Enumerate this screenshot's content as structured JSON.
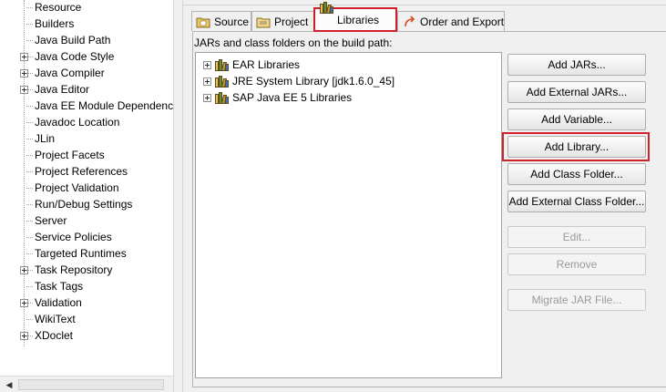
{
  "left_tree": {
    "items": [
      {
        "label": "Resource",
        "expandable": false
      },
      {
        "label": "Builders",
        "expandable": false
      },
      {
        "label": "Java Build Path",
        "expandable": false
      },
      {
        "label": "Java Code Style",
        "expandable": true
      },
      {
        "label": "Java Compiler",
        "expandable": true
      },
      {
        "label": "Java Editor",
        "expandable": true
      },
      {
        "label": "Java EE Module Dependenc",
        "expandable": false
      },
      {
        "label": "Javadoc Location",
        "expandable": false
      },
      {
        "label": "JLin",
        "expandable": false
      },
      {
        "label": "Project Facets",
        "expandable": false
      },
      {
        "label": "Project References",
        "expandable": false
      },
      {
        "label": "Project Validation",
        "expandable": false
      },
      {
        "label": "Run/Debug Settings",
        "expandable": false
      },
      {
        "label": "Server",
        "expandable": false
      },
      {
        "label": "Service Policies",
        "expandable": false
      },
      {
        "label": "Targeted Runtimes",
        "expandable": false
      },
      {
        "label": "Task Repository",
        "expandable": true
      },
      {
        "label": "Task Tags",
        "expandable": false
      },
      {
        "label": "Validation",
        "expandable": true
      },
      {
        "label": "WikiText",
        "expandable": false
      },
      {
        "label": "XDoclet",
        "expandable": true
      }
    ]
  },
  "tabs": [
    {
      "label": "Source",
      "icon": "source-folder-icon"
    },
    {
      "label": "Project",
      "icon": "project-folder-icon"
    },
    {
      "label": "Libraries",
      "icon": "libraries-icon",
      "active": true
    },
    {
      "label": "Order and Export",
      "icon": "order-export-icon"
    }
  ],
  "build_path_label": "JARs and class folders on the build path:",
  "libraries": [
    {
      "label": "EAR Libraries"
    },
    {
      "label": "JRE System Library [jdk1.6.0_45]"
    },
    {
      "label": "SAP Java EE 5 Libraries"
    }
  ],
  "buttons": {
    "add_jars": "Add JARs...",
    "add_external_jars": "Add External JARs...",
    "add_variable": "Add Variable...",
    "add_library": "Add Library...",
    "add_class_folder": "Add Class Folder...",
    "add_external_class_folder": "Add External Class Folder...",
    "edit": "Edit...",
    "remove": "Remove",
    "migrate_jar": "Migrate JAR File..."
  },
  "colors": {
    "highlight": "#d0202a",
    "panel_bg": "#f0f0f0"
  }
}
